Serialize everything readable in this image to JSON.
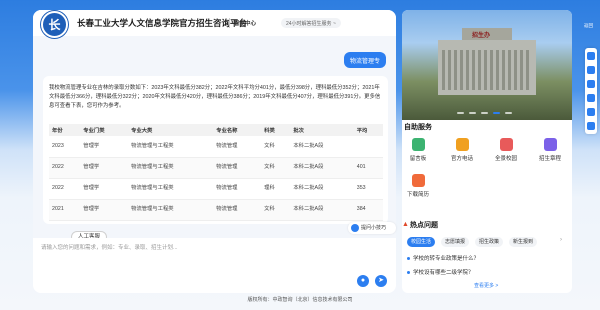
{
  "header": {
    "logo_text": "长",
    "title": "长春工业大学人文信息学院官方招生咨询平台",
    "tag": "智能中心",
    "subtitle": "24小时解答招生服务 ~"
  },
  "chat": {
    "user_message": "物流管理专",
    "answer_intro": "我校物流管理专业在吉林的录取分数如下：2023年文科最低分382分；2022年文科平均分401分，最低分398分，理科最低分352分；2021年文科最低分366分，理科最低分322分；2020年文科最低分420分，理科最低分386分；2019年文科最低分407分，理科最低分391分。更多信息可查看下表，您可作为参考。",
    "table": {
      "headers": [
        "年份",
        "专业门类",
        "专业大类",
        "专业名称",
        "科类",
        "批次",
        "平均"
      ],
      "rows": [
        [
          "2023",
          "管理学",
          "物流管理与工程类",
          "物流管理",
          "文科",
          "本科二批A段",
          ""
        ],
        [
          "2022",
          "管理学",
          "物流管理与工程类",
          "物流管理",
          "文科",
          "本科二批A段",
          "401"
        ],
        [
          "2022",
          "管理学",
          "物流管理与工程类",
          "物流管理",
          "理科",
          "本科二批A段",
          "353"
        ],
        [
          "2021",
          "管理学",
          "物流管理与工程类",
          "物流管理",
          "文科",
          "本科二批A段",
          "384"
        ]
      ]
    },
    "human_service_label": "人工客服",
    "tip_label": "提问小技巧",
    "input_placeholder": "请输入您的问题和需求，例如：专业、录取、招生计划..."
  },
  "right": {
    "building_sign": "招生办",
    "services_title": "自助服务",
    "services": [
      {
        "label": "留言板",
        "icon": "message-board-icon",
        "color": "#3cb371"
      },
      {
        "label": "官方电话",
        "icon": "phone-icon",
        "color": "#f0a020"
      },
      {
        "label": "全景校园",
        "icon": "campus-icon",
        "color": "#e85a5a"
      },
      {
        "label": "招生章程",
        "icon": "document-icon",
        "color": "#7b61e8"
      },
      {
        "label": "下载简历",
        "icon": "download-icon",
        "color": "#f06a3a"
      }
    ],
    "hot_title": "热点问题",
    "hot_tabs": [
      "校园生活",
      "志愿填报",
      "招生政策",
      "新生报到"
    ],
    "hot_questions": [
      "学校的转专业政策是什么？",
      "学校设有哪些二级学院？"
    ],
    "more_label": "查看更多 >"
  },
  "footer": {
    "text": "版权所有：中政智询（北京）信息技术有限公司"
  },
  "side": {
    "top_label": "返回"
  }
}
